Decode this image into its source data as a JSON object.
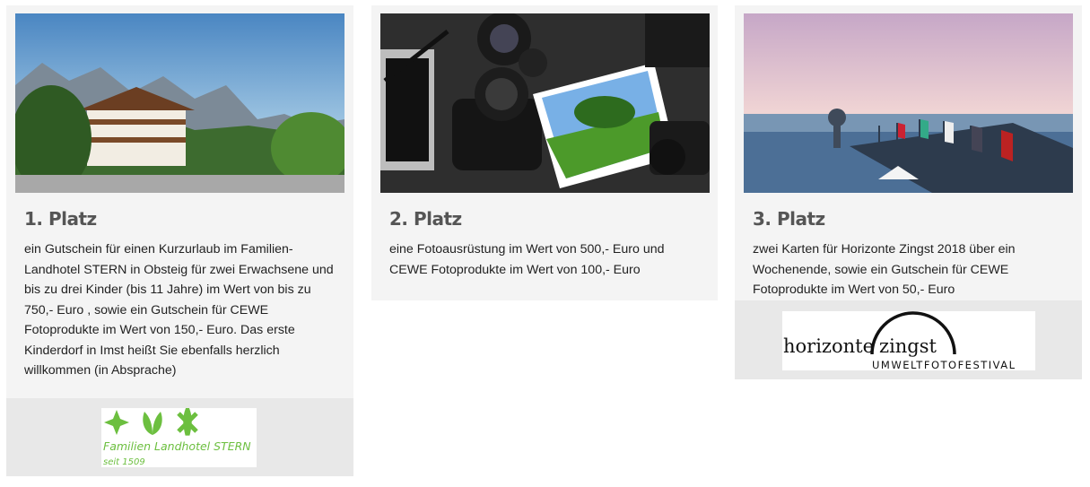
{
  "prizes": [
    {
      "title": "1. Platz",
      "text": "ein Gutschein für einen Kurzurlaub im Familien-Landhotel STERN in Obsteig für zwei Erwachsene und bis zu drei Kinder (bis 11 Jahre) im Wert von bis zu 750,- Euro , sowie ein Gutschein für CEWE Fotoprodukte im Wert von 150,- Euro. Das erste Kinderdorf in Imst heißt Sie ebenfalls herzlich willkommen (in Absprache)",
      "photo": "hotel-alps-photo"
    },
    {
      "title": "2. Platz",
      "text": "eine Fotoausrüstung im Wert von 500,- Euro und CEWE Fotoprodukte im Wert von 100,- Euro",
      "photo": "camera-equipment-photo"
    },
    {
      "title": "3. Platz",
      "text": "zwei Karten für Horizonte Zingst 2018 über ein Wochenende, sowie ein Gutschein für CEWE Fotoprodukte im Wert von 50,- Euro",
      "photo": "pier-flags-photo"
    }
  ],
  "logos": {
    "stern": {
      "name": "Familien Landhotel STERN",
      "since": "seit 1509",
      "color": "#6cbf3f"
    },
    "zingst": {
      "word1": "horizonte",
      "word2": "zingst",
      "subtitle": "UMWELTFOTOFESTIVAL",
      "color": "#111111"
    }
  }
}
